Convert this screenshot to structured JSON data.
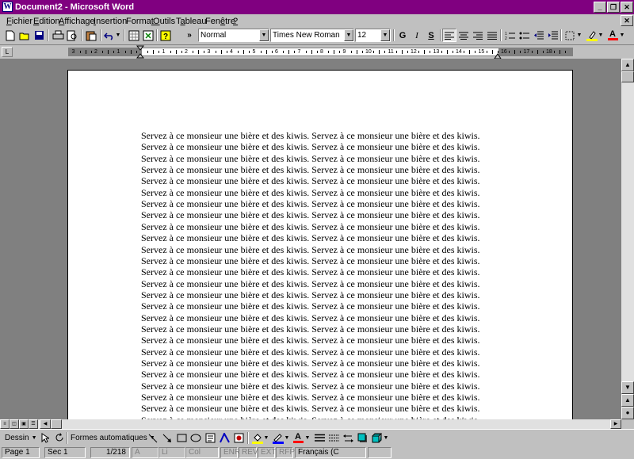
{
  "window": {
    "title": "Document2 - Microsoft Word",
    "icon": "W"
  },
  "menu": [
    {
      "pre": "",
      "ul": "F",
      "post": "ichier"
    },
    {
      "pre": "",
      "ul": "E",
      "post": "dition"
    },
    {
      "pre": "",
      "ul": "A",
      "post": "ffichage"
    },
    {
      "pre": "",
      "ul": "I",
      "post": "nsertion"
    },
    {
      "pre": "Forma",
      "ul": "t",
      "post": ""
    },
    {
      "pre": "",
      "ul": "O",
      "post": "utils"
    },
    {
      "pre": "T",
      "ul": "a",
      "post": "bleau"
    },
    {
      "pre": "Fen",
      "ul": "ê",
      "post": "tre"
    },
    {
      "pre": "",
      "ul": "?",
      "post": ""
    }
  ],
  "toolbar": {
    "style_value": "Normal",
    "font_value": "Times New Roman",
    "size_value": "12",
    "bold_label": "G",
    "italic_label": "I",
    "underline_label": "S",
    "more_label": "»",
    "font_color_label": "A"
  },
  "ruler": {
    "labels": [
      "3",
      "2",
      "1",
      "1",
      "2",
      "3",
      "4",
      "5",
      "6",
      "7",
      "8",
      "9",
      "10",
      "11",
      "12",
      "13",
      "14",
      "15",
      "16",
      "17",
      "18"
    ]
  },
  "document": {
    "sentence": "Servez à ce monsieur une bière et des kiwis. Servez à ce monsieur une bière et des kiwis.",
    "line_count": 28
  },
  "drawing": {
    "draw_label": "Dessin",
    "autoshapes_label": "Formes automatiques",
    "font_color_label": "A"
  },
  "status": {
    "page": "Page  1",
    "section": "Sec  1",
    "pages": "1/218",
    "at": "À",
    "line": "Li",
    "col": "Col",
    "enr": "ENR",
    "rev": "REV",
    "ext": "EXT",
    "rfp": "RFP",
    "language": "Français (C"
  }
}
